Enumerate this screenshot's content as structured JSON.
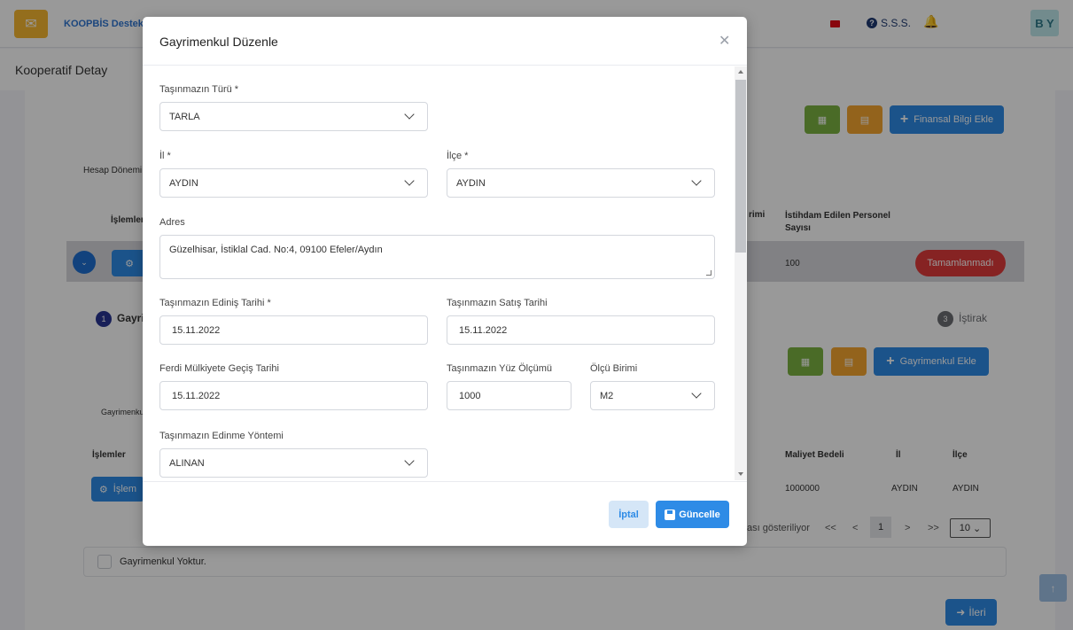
{
  "header": {
    "brand": "KOOPBİS Destek",
    "faq_label": "S.S.S.",
    "user_initials": "B Y"
  },
  "subheader": {
    "title": "Kooperatif Detay"
  },
  "background": {
    "add_financial_label": "Finansal Bilgi Ekle",
    "period_filter": "Hesap Dönemi",
    "actions_header": "İşlemler",
    "col_unit_partial": "rimi",
    "col_staff": "İstihdam Edilen Personel Sayısı",
    "staff_value": "100",
    "status_badge": "Tamamlanmadı",
    "step1_num": "1",
    "step1_label": "Gayri",
    "step3_num": "3",
    "step3_label": "İştirak",
    "add_property_label": "Gayrimenkul Ekle",
    "property_filter": "Gayrimenku",
    "actions_header2": "İşlemler",
    "actions_btn": "İşlem",
    "col_cost": "Maliyet Bedeli",
    "col_city": "İl",
    "col_district": "İlçe",
    "cost_value": "1000000",
    "city_value": "AYDIN",
    "district_value": "AYDIN",
    "pager_text": "ası gösteriliyor",
    "pager_first": "<<",
    "pager_prev": "<",
    "pager_page": "1",
    "pager_next": ">",
    "pager_last": ">>",
    "page_size": "10",
    "no_property_label": "Gayrimenkul Yoktur.",
    "next_label": "İleri"
  },
  "modal": {
    "title": "Gayrimenkul Düzenle",
    "fields": {
      "property_type_label": "Taşınmazın Türü *",
      "property_type_value": "TARLA",
      "city_label": "İl *",
      "city_value": "AYDIN",
      "district_label": "İlçe *",
      "district_value": "AYDIN",
      "address_label": "Adres",
      "address_value": "Güzelhisar, İstiklal Cad. No:4, 09100 Efeler/Aydın",
      "acquisition_date_label": "Taşınmazın Ediniş Tarihi *",
      "acquisition_date_value": "15.11.2022",
      "sale_date_label": "Taşınmazın Satış Tarihi",
      "sale_date_value": "15.11.2022",
      "ownership_date_label": "Ferdi Mülkiyete Geçiş Tarihi",
      "ownership_date_value": "15.11.2022",
      "area_label": "Taşınmazın Yüz Ölçümü",
      "area_value": "1000",
      "unit_label": "Ölçü Birimi",
      "unit_value": "M2",
      "method_label": "Taşınmazın Edinme Yöntemi",
      "method_value": "ALINAN"
    },
    "cancel_label": "İptal",
    "update_label": "Güncelle"
  },
  "colors": {
    "primary": "#2e8be6",
    "danger": "#e03b3b",
    "success": "#7cb342",
    "warning": "#f6a630"
  }
}
